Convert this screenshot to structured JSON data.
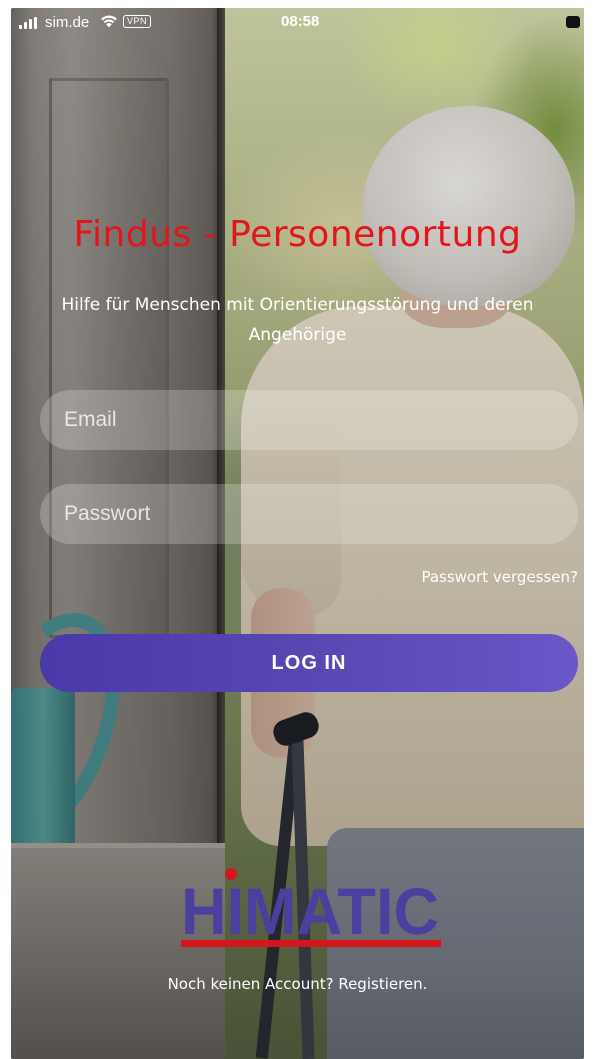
{
  "status_bar": {
    "carrier": "sim.de",
    "vpn": "VPN",
    "time": "08:58"
  },
  "login": {
    "title": "Findus - Personenortung",
    "subtitle": "Hilfe für Menschen mit Orientierungsstörung und deren Angehörige",
    "email_placeholder": "Email",
    "email_value": "",
    "password_placeholder": "Passwort",
    "password_value": "",
    "forgot_password": "Passwort vergessen?",
    "login_button": "LOG IN",
    "register_prompt": "Noch keinen Account? Registieren."
  },
  "brand": {
    "logo_text": "HIMATIC",
    "logo_color": "#4b3fa0",
    "logo_dot_color": "#d7141a"
  },
  "colors": {
    "title_red": "#e3151b",
    "button_start": "#4a39a8",
    "button_end": "#6a57c8",
    "field_bg": "rgba(255,255,255,0.22)"
  },
  "icons": [
    "signal-icon",
    "wifi-icon",
    "vpn-badge",
    "battery-icon"
  ]
}
